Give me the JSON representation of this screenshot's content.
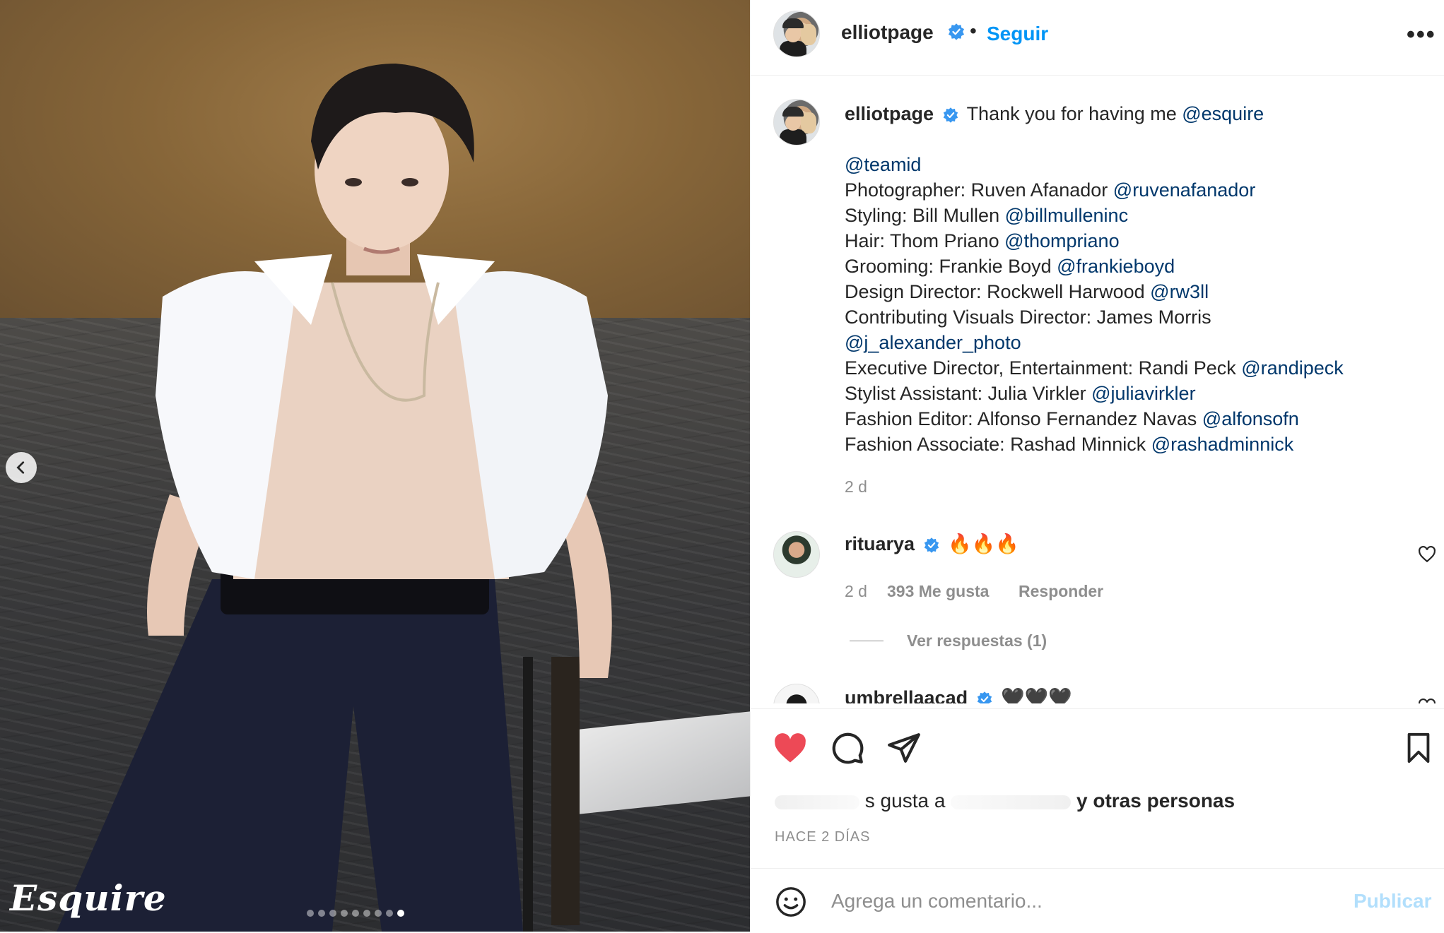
{
  "post": {
    "username": "elliotpage",
    "follow_label": "Seguir",
    "bullet": "•",
    "more_icon": "more-horizontal-icon"
  },
  "photo": {
    "logo_text": "Esquire",
    "carousel_count": 9,
    "carousel_active_index": 9
  },
  "caption": {
    "username": "elliotpage",
    "intro": "Thank you for having me ",
    "intro_mention": "@esquire",
    "lines": [
      {
        "label": "",
        "mention": "@teamid"
      },
      {
        "label": "Photographer: Ruven Afanador ",
        "mention": "@ruvenafanador"
      },
      {
        "label": "Styling: Bill Mullen ",
        "mention": "@billmulleninc"
      },
      {
        "label": "Hair: Thom Priano ",
        "mention": "@thompriano"
      },
      {
        "label": "Grooming: Frankie Boyd ",
        "mention": "@frankieboyd"
      },
      {
        "label": "Design Director: Rockwell Harwood ",
        "mention": "@rw3ll"
      },
      {
        "label": "Contributing Visuals Director: James Morris",
        "mention": ""
      },
      {
        "label": "",
        "mention": "@j_alexander_photo"
      },
      {
        "label": "Executive Director, Entertainment: Randi Peck ",
        "mention": "@randipeck"
      },
      {
        "label": "Stylist Assistant: Julia Virkler ",
        "mention": "@juliavirkler"
      },
      {
        "label": "Fashion Editor: Alfonso Fernandez Navas ",
        "mention": "@alfonsofn"
      },
      {
        "label": "Fashion Associate: Rashad Minnick ",
        "mention": "@rashadminnick"
      }
    ],
    "time": "2 d"
  },
  "comments": [
    {
      "username": "rituarya",
      "text": "🔥🔥🔥",
      "time": "2 d",
      "likes": "393 Me gusta",
      "reply": "Responder",
      "view_replies": "Ver respuestas (1)"
    },
    {
      "username": "umbrellaacad",
      "text": "🖤🖤🖤"
    }
  ],
  "actions": {
    "likes_prefix": "s gusta a",
    "likes_suffix": "y otras personas",
    "time_ago": "HACE 2 DÍAS",
    "comment_placeholder": "Agrega un comentario...",
    "publish_label": "Publicar"
  },
  "colors": {
    "like_red": "#ed4956",
    "link_blue": "#0095f6",
    "mention": "#00376b",
    "verified_blue": "#3897f0"
  }
}
